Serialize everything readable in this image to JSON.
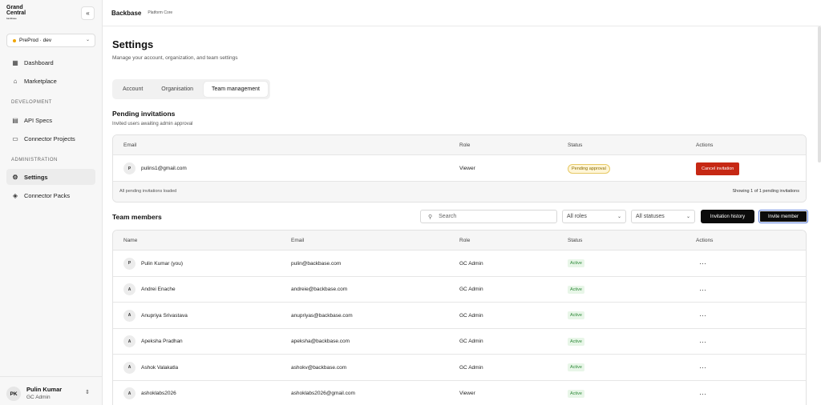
{
  "sidebar": {
    "logo": {
      "line1": "Grand",
      "line2": "Central",
      "sub": "backbase"
    },
    "collapse_icon": "«",
    "environment": "PreProd · dev",
    "items": [
      {
        "label": "Dashboard",
        "icon": "dashboard-icon",
        "glyph": "▦"
      },
      {
        "label": "Marketplace",
        "icon": "store-icon",
        "glyph": "⌂"
      },
      {
        "label": "API Specs",
        "icon": "file-icon",
        "glyph": "▤"
      },
      {
        "label": "Connector Projects",
        "icon": "folder-icon",
        "glyph": "▭"
      },
      {
        "label": "Settings",
        "icon": "gear-icon",
        "glyph": "⚙"
      },
      {
        "label": "Connector Packs",
        "icon": "package-icon",
        "glyph": "◈"
      }
    ],
    "sections": {
      "development": "DEVELOPMENT",
      "administration": "ADMINISTRATION"
    },
    "user": {
      "initials": "PK",
      "name": "Pulin Kumar",
      "role": "GC Admin"
    }
  },
  "header": {
    "brand": "Backbase",
    "sub": "Platform Core"
  },
  "page": {
    "title": "Settings",
    "subtitle": "Manage your account, organization, and team settings"
  },
  "tabs": [
    "Account",
    "Organisation",
    "Team management"
  ],
  "pending": {
    "title": "Pending invitations",
    "subtitle": "Invited users awaiting admin approval",
    "columns": [
      "Email",
      "Role",
      "Status",
      "Actions"
    ],
    "rows": [
      {
        "initial": "P",
        "email": "pulins1@gmail.com",
        "role": "Viewer",
        "status": "Pending approval",
        "action": "Cancel invitation"
      }
    ],
    "footer_left": "All pending invitations loaded",
    "footer_right": "Showing 1 of 1 pending invitations"
  },
  "team": {
    "title": "Team members",
    "search_placeholder": "Search",
    "roles_filter": "All roles",
    "status_filter": "All statuses",
    "history_button": "Invitation history",
    "invite_button": "Invite member",
    "columns": [
      "Name",
      "Email",
      "Role",
      "Status",
      "Actions"
    ],
    "rows": [
      {
        "initial": "P",
        "name": "Pulin Kumar (you)",
        "email": "pulin@backbase.com",
        "role": "GC Admin",
        "status": "Active"
      },
      {
        "initial": "A",
        "name": "Andrei Enache",
        "email": "andreie@backbase.com",
        "role": "GC Admin",
        "status": "Active"
      },
      {
        "initial": "A",
        "name": "Anupriya Srivastava",
        "email": "anupriyas@backbase.com",
        "role": "GC Admin",
        "status": "Active"
      },
      {
        "initial": "A",
        "name": "Apeksha Pradhan",
        "email": "apeksha@backbase.com",
        "role": "GC Admin",
        "status": "Active"
      },
      {
        "initial": "A",
        "name": "Ashok Valakatla",
        "email": "ashokv@backbase.com",
        "role": "GC Admin",
        "status": "Active"
      },
      {
        "initial": "A",
        "name": "ashoklabs2026",
        "email": "ashoklabs2026@gmail.com",
        "role": "Viewer",
        "status": "Active"
      }
    ],
    "row_action": "···"
  },
  "colors": {
    "accent": "#0b0b0b",
    "danger": "#c62814",
    "active_green": "#2f8a3a",
    "pending_yellow": "#fff5d6"
  }
}
